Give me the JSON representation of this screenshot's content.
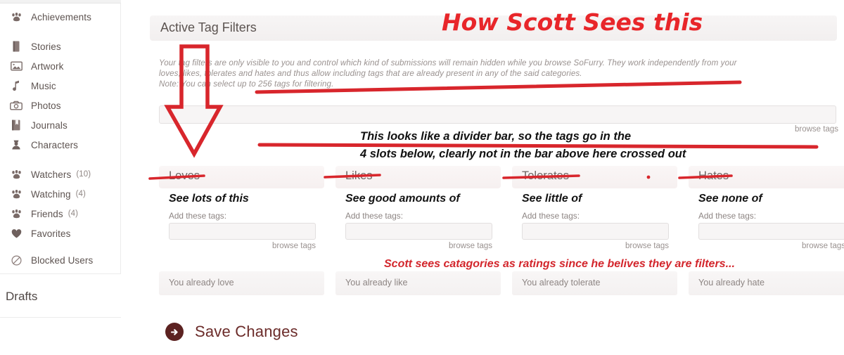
{
  "sidebar": {
    "items": [
      {
        "label": "Achievements",
        "icon": "paw-icon",
        "count": ""
      },
      {
        "label": "Stories",
        "icon": "book-icon",
        "count": ""
      },
      {
        "label": "Artwork",
        "icon": "image-icon",
        "count": ""
      },
      {
        "label": "Music",
        "icon": "music-note-icon",
        "count": ""
      },
      {
        "label": "Photos",
        "icon": "camera-icon",
        "count": ""
      },
      {
        "label": "Journals",
        "icon": "journal-icon",
        "count": ""
      },
      {
        "label": "Characters",
        "icon": "character-icon",
        "count": ""
      },
      {
        "label": "Watchers",
        "icon": "paw-icon",
        "count": "(10)"
      },
      {
        "label": "Watching",
        "icon": "paw-icon",
        "count": "(4)"
      },
      {
        "label": "Friends",
        "icon": "paw-icon",
        "count": "(4)"
      },
      {
        "label": "Favorites",
        "icon": "heart-icon",
        "count": ""
      },
      {
        "label": "Blocked Users",
        "icon": "block-icon",
        "count": ""
      }
    ],
    "drafts_title": "Drafts"
  },
  "panel": {
    "title": "Active Tag Filters",
    "description_line1": "Your tag filters are only visible to you and control which kind of submissions will remain hidden while you browse SoFurry. They work independently from your",
    "description_line2": "loves, likes, tolerates and hates and thus allow including tags that are already present in any of the said categories.",
    "description_line3": "Note: You can select up to 256 tags for filtering.",
    "main_input_value": "",
    "main_input_placeholder": "",
    "browse_tags_label": "browse tags"
  },
  "columns": [
    {
      "header": "Loves",
      "subtitle": "See lots of this",
      "add_label": "Add these tags:",
      "input_value": "",
      "browse_label": "browse tags",
      "already_label": "You already love"
    },
    {
      "header": "Likes",
      "subtitle": "See good amounts of",
      "add_label": "Add these tags:",
      "input_value": "",
      "browse_label": "browse tags",
      "already_label": "You already like"
    },
    {
      "header": "Tolerates",
      "subtitle": "See little of",
      "add_label": "Add these tags:",
      "input_value": "",
      "browse_label": "browse tags",
      "already_label": "You already tolerate"
    },
    {
      "header": "Hates",
      "subtitle": "See none of",
      "add_label": "Add these tags:",
      "input_value": "",
      "browse_label": "browse tags",
      "already_label": "You already hate"
    }
  ],
  "save": {
    "label": "Save Changes",
    "icon": "arrow-right-circle-icon"
  },
  "annotations": {
    "title": "How Scott Sees this",
    "middle_line1": "This looks like a divider bar, so the tags go in the",
    "middle_line2": "4 slots below, clearly not in the bar above here crossed out",
    "bottom": "Scott sees catagories as  ratings since he belives they are filters..."
  },
  "colors": {
    "annotation_red": "#e8262a",
    "strike_red": "#d82128",
    "save_maroon": "#6b2b29",
    "sidebar_text": "#5d5350",
    "muted_text": "#9a9290"
  }
}
